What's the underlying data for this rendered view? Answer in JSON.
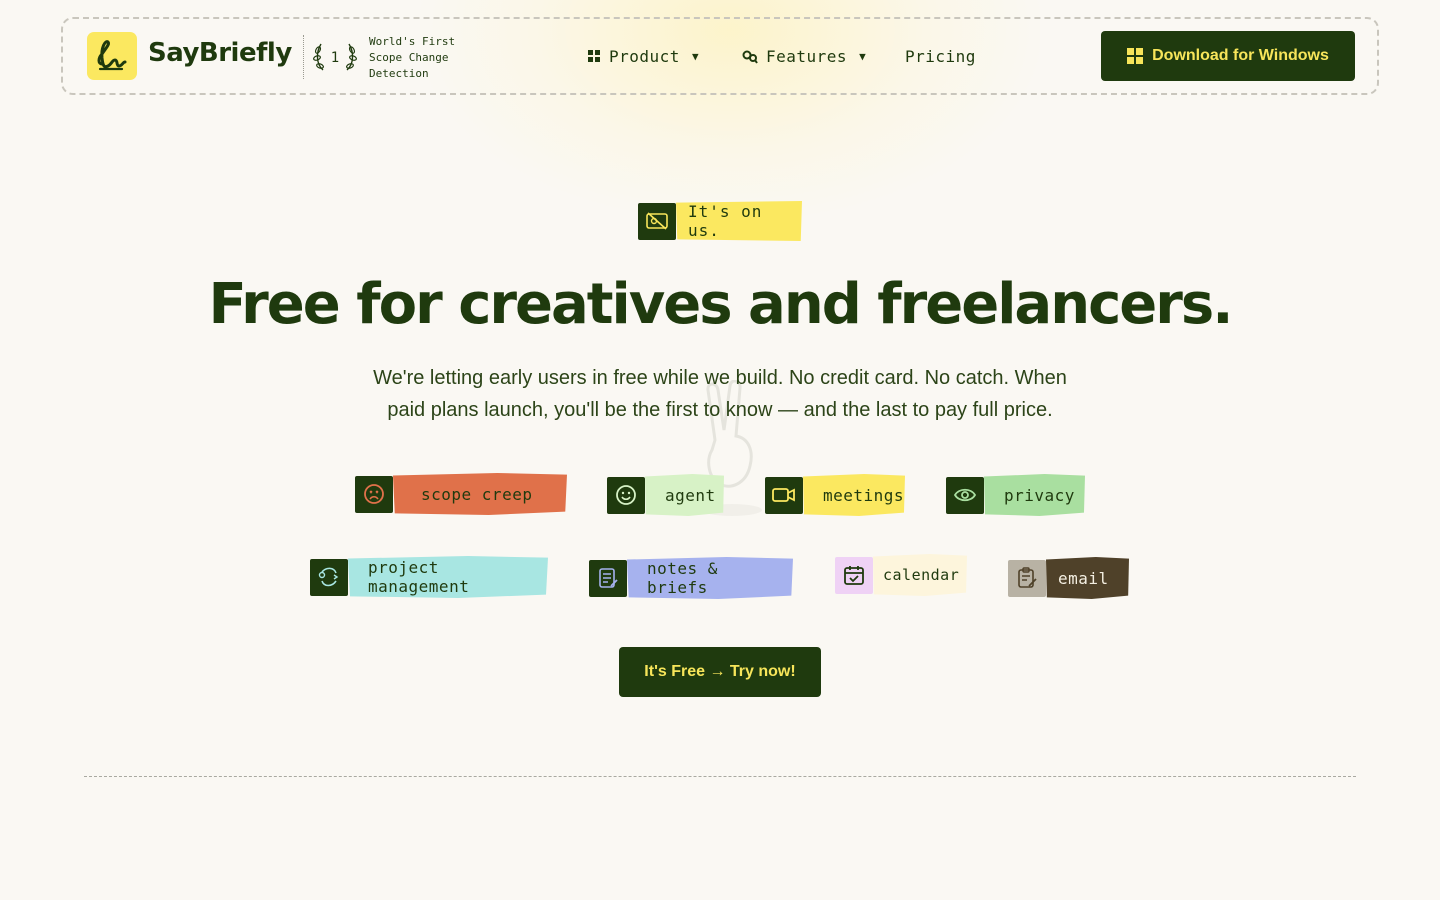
{
  "header": {
    "brand": "SayBriefly",
    "award_number": "1",
    "award_lines": [
      "World's First",
      "Scope Change",
      "Detection"
    ],
    "nav": [
      {
        "label": "Product",
        "icon": "grid-icon",
        "has_caret": true
      },
      {
        "label": "Features",
        "icon": "search-tools-icon",
        "has_caret": true
      },
      {
        "label": "Pricing",
        "has_caret": false
      }
    ],
    "download_label": "Download for Windows"
  },
  "hero": {
    "badge": "It's on us.",
    "title": "Free for creatives and freelancers.",
    "subtitle": "We're letting early users in free while we build. No credit card. No catch. When paid plans launch, you'll be the first to know — and the last to pay full price.",
    "cta_label": "It's Free → Try now!"
  },
  "tags": [
    {
      "label": "scope creep",
      "icon": "sad-face-icon",
      "color": "#e0714a",
      "icon_bg": "#1f3a0e"
    },
    {
      "label": "agent",
      "icon": "smile-face-icon",
      "color": "#d7f2c6",
      "icon_bg": "#1f3a0e"
    },
    {
      "label": "meetings",
      "icon": "video-camera-icon",
      "color": "#fbe860",
      "icon_bg": "#1f3a0e"
    },
    {
      "label": "privacy",
      "icon": "eye-icon",
      "color": "#a9dfa0",
      "icon_bg": "#1f3a0e"
    },
    {
      "label": "project management",
      "icon": "workflow-icon",
      "color": "#a8e6e2",
      "icon_bg": "#1f3a0e"
    },
    {
      "label": "notes & briefs",
      "icon": "notepad-icon",
      "color": "#a6b2ee",
      "icon_bg": "#1f3a0e"
    },
    {
      "label": "calendar",
      "icon": "calendar-check-icon",
      "color": "#fdf5dc",
      "icon_bg": "#efd2f5"
    },
    {
      "label": "email",
      "icon": "clipboard-edit-icon",
      "color": "#4f4129",
      "icon_bg": "#b8b2a4"
    }
  ]
}
